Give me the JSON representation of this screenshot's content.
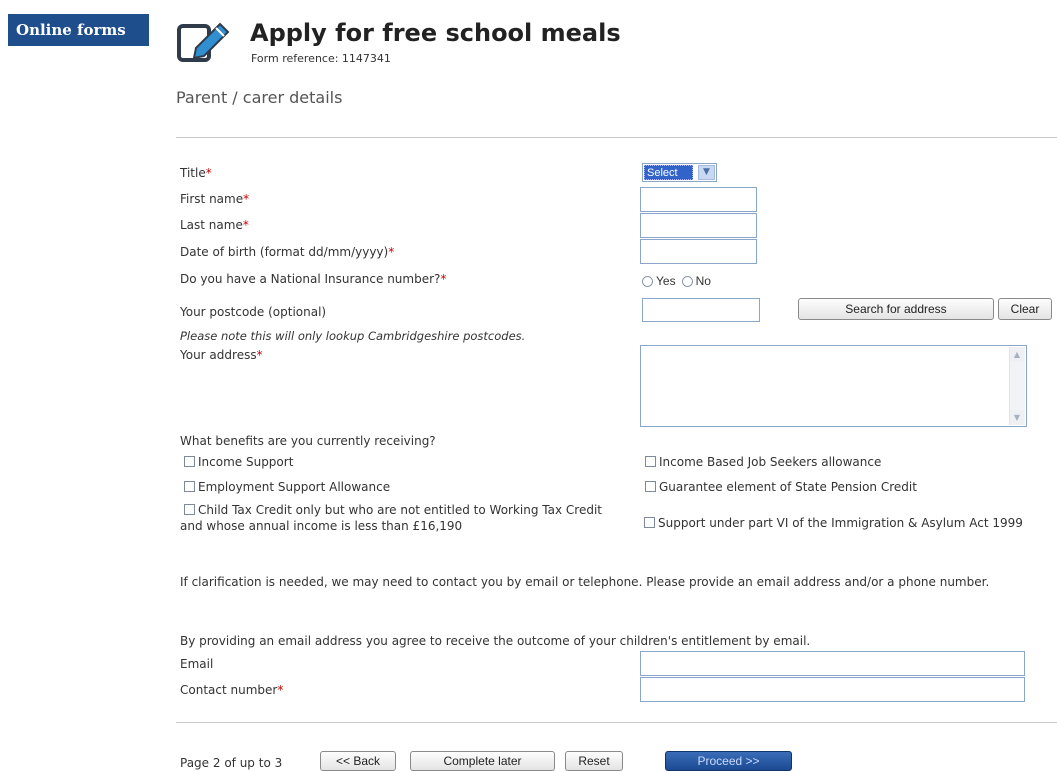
{
  "sidebar": {
    "online_forms": "Online forms"
  },
  "header": {
    "title": "Apply for free school meals",
    "form_reference": "Form reference: 1147341",
    "section": "Parent / carer details"
  },
  "fields": {
    "title_label": "Title",
    "title_select_value": "Select",
    "first_name_label": "First name",
    "last_name_label": "Last name",
    "dob_label": "Date of birth (format dd/mm/yyyy)",
    "ni_label": "Do you have a National Insurance number?",
    "ni_options": [
      "Yes",
      "No"
    ],
    "postcode_label": "Your postcode (optional)",
    "postcode_note": "Please note this will only lookup Cambridgeshire postcodes.",
    "search_button": "Search for address",
    "clear_button": "Clear",
    "address_label": "Your address",
    "required_marker": "*"
  },
  "benefits": {
    "question": "What benefits are you currently receiving?",
    "income_support": "Income Support",
    "employment_support": "Employment Support Allowance",
    "child_tax_credit": "Child Tax Credit only but who are not entitled to Working Tax Credit and whose annual income is less than £16,190",
    "jobseekers": "Income Based Job Seekers allowance",
    "pension_credit": "Guarantee element of State Pension Credit",
    "immigration": "Support under part VI of the Immigration & Asylum Act 1999"
  },
  "contact": {
    "clarification": "If clarification is needed, we may need to contact you by email or telephone. Please provide an email address and/or a phone number.",
    "consent": "By providing an email address you agree to receive the outcome of your children's entitlement by email.",
    "email_label": "Email",
    "contact_number_label": "Contact number"
  },
  "footer": {
    "page_indicator": "Page 2 of up to 3",
    "back_button": "<< Back",
    "complete_later_button": "Complete later",
    "reset_button": "Reset",
    "proceed_button": "Proceed >>"
  },
  "colors": {
    "brand_blue": "#1f4e8c",
    "required_red": "#cc0000",
    "primary_button": "#1b4a92"
  },
  "icons": {
    "form": "form-edit-icon"
  }
}
